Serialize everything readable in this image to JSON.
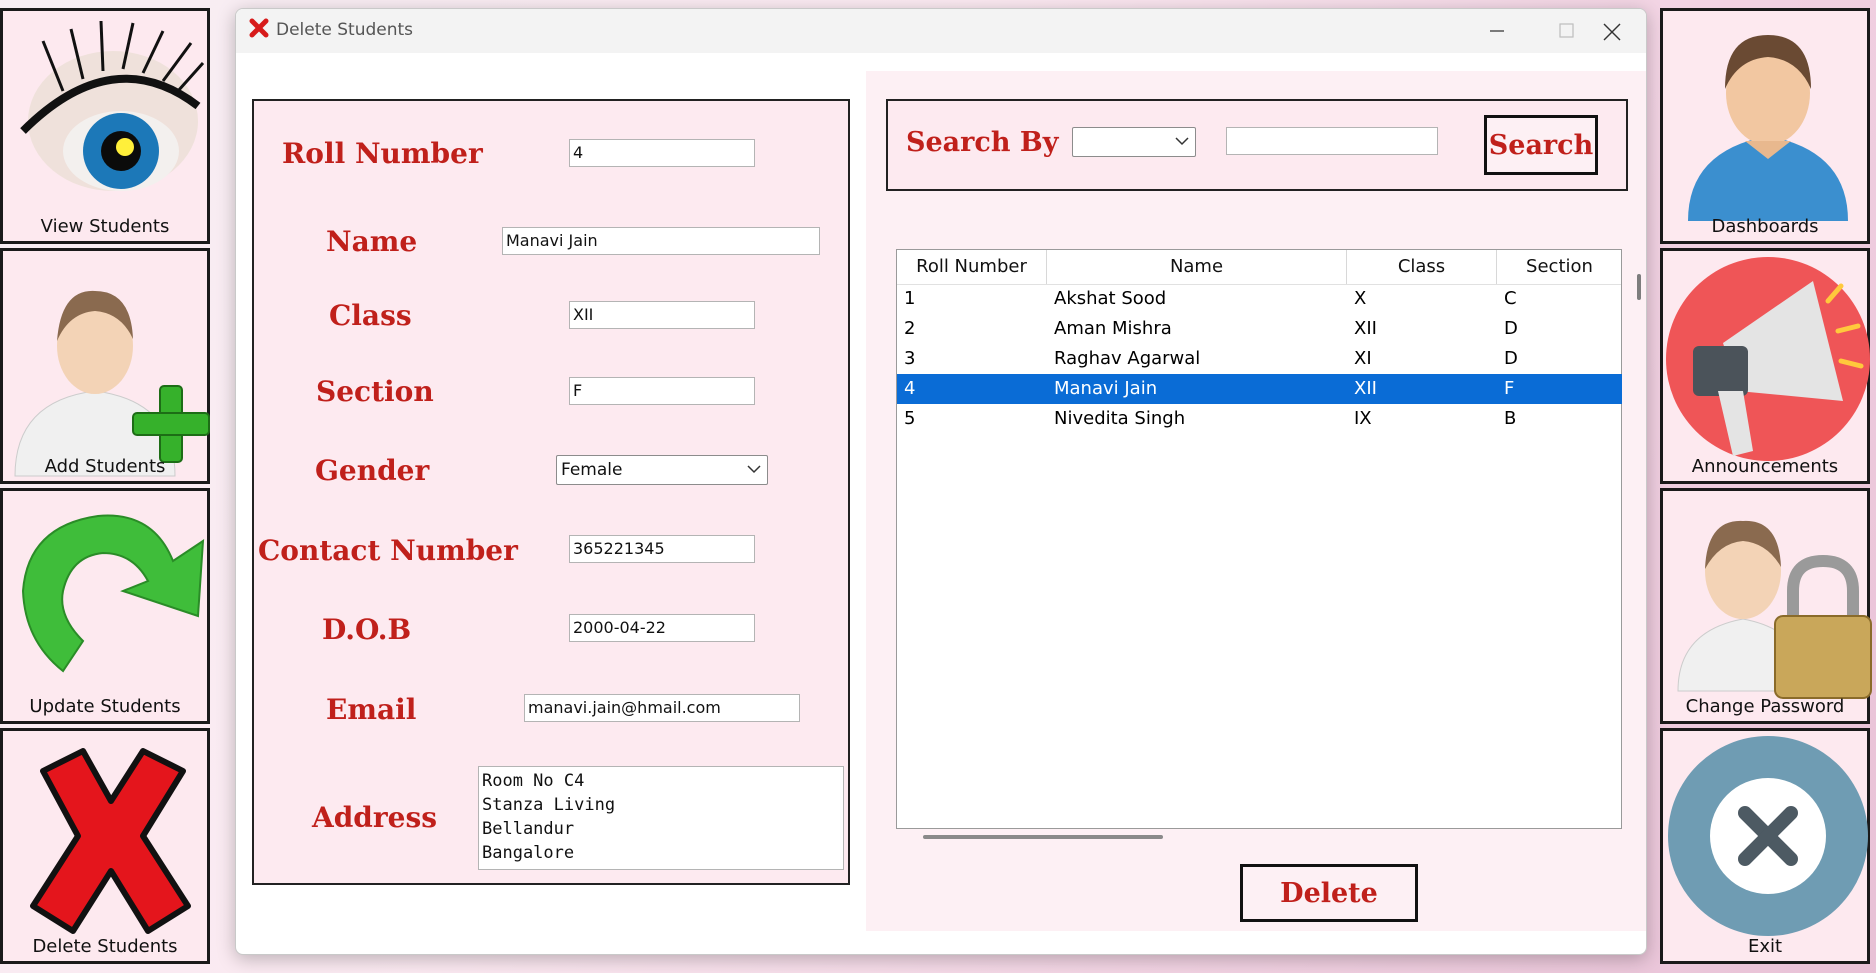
{
  "left_nav": [
    {
      "label": "View Students",
      "icon": "eye-icon"
    },
    {
      "label": "Add Students",
      "icon": "add-user-icon"
    },
    {
      "label": "Update Students",
      "icon": "refresh-arrow-icon"
    },
    {
      "label": "Delete Students",
      "icon": "red-x-icon"
    }
  ],
  "right_nav": [
    {
      "label": "Dashboards",
      "icon": "user-avatar-icon"
    },
    {
      "label": "Announcements",
      "icon": "megaphone-icon"
    },
    {
      "label": "Change Password",
      "icon": "user-lock-icon"
    },
    {
      "label": "Exit",
      "icon": "exit-circle-icon"
    }
  ],
  "window": {
    "title": "Delete Students",
    "controls": [
      "minimize",
      "maximize",
      "close"
    ]
  },
  "form": {
    "roll_number": {
      "label": "Roll Number",
      "value": "4"
    },
    "name": {
      "label": "Name",
      "value": "Manavi Jain"
    },
    "class": {
      "label": "Class",
      "value": "XII"
    },
    "section": {
      "label": "Section",
      "value": "F"
    },
    "gender": {
      "label": "Gender",
      "value": "Female"
    },
    "contact": {
      "label": "Contact Number",
      "value": "365221345"
    },
    "dob": {
      "label": "D.O.B",
      "value": "2000-04-22"
    },
    "email": {
      "label": "Email",
      "value": "manavi.jain@hmail.com"
    },
    "address": {
      "label": "Address",
      "lines": [
        "Room No C4",
        "Stanza Living",
        "Bellandur",
        "Bangalore"
      ]
    }
  },
  "search": {
    "label": "Search By",
    "select_value": "",
    "query": "",
    "button": "Search"
  },
  "table": {
    "columns": [
      "Roll Number",
      "Name",
      "Class",
      "Section"
    ],
    "rows": [
      [
        "1",
        "Akshat Sood",
        "X",
        "C"
      ],
      [
        "2",
        "Aman Mishra",
        "XII",
        "D"
      ],
      [
        "3",
        "Raghav Agarwal",
        "XI",
        "D"
      ],
      [
        "4",
        "Manavi Jain",
        "XII",
        "F"
      ],
      [
        "5",
        "Nivedita Singh",
        "IX",
        "B"
      ]
    ],
    "selected_row": 3
  },
  "delete_button": "Delete",
  "colors": {
    "label_red": "#c0201b",
    "panel_pink": "#fdeaf0",
    "selection_blue": "#0a6cd6"
  }
}
